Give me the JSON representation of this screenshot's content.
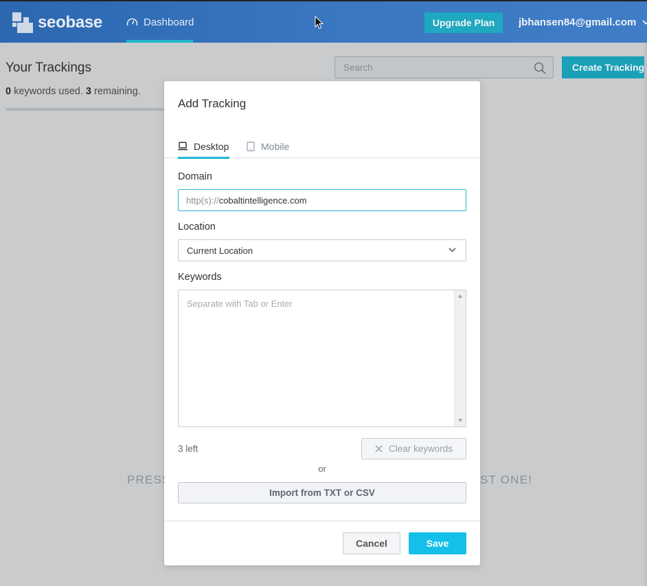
{
  "header": {
    "logo_text": "seobase",
    "nav_dashboard": "Dashboard",
    "upgrade_label": "Upgrade Plan",
    "user_email": "jbhansen84@gmail.com"
  },
  "page": {
    "title": "Your Trackings",
    "keywords_used": "0",
    "keywords_used_text": " keywords used. ",
    "keywords_remaining": "3",
    "keywords_remaining_text": " remaining.",
    "search_placeholder": "Search",
    "create_label": "Create Tracking",
    "empty_left": "PRESS",
    "empty_right": "ST ONE!"
  },
  "modal": {
    "title": "Add Tracking",
    "tabs": [
      {
        "label": "Desktop",
        "active": true
      },
      {
        "label": "Mobile",
        "active": false
      }
    ],
    "domain_label": "Domain",
    "domain_prefix": "http(s)://",
    "domain_value": "cobaltintelligence.com",
    "location_label": "Location",
    "location_value": "Current Location",
    "keywords_label": "Keywords",
    "keywords_placeholder": "Separate with Tab or Enter",
    "left_count": "3 left",
    "clear_label": "Clear keywords",
    "or_text": "or",
    "import_label": "Import from TXT or CSV",
    "cancel_label": "Cancel",
    "save_label": "Save"
  },
  "colors": {
    "header_bg": "#3a78c2",
    "accent": "#1fb8cc",
    "save_button": "#14c0e8"
  }
}
